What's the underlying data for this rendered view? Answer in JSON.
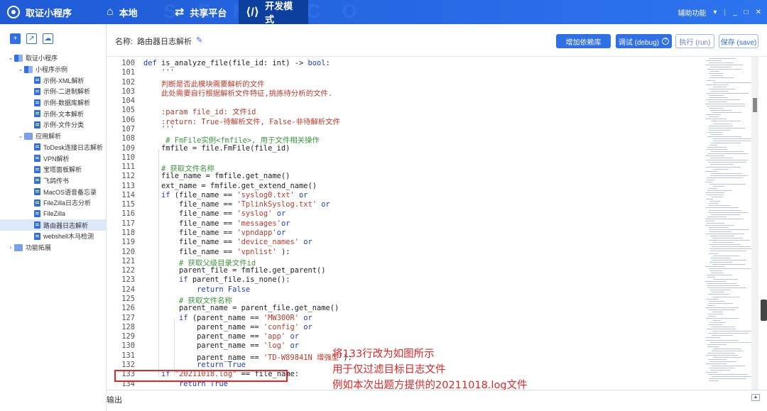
{
  "app": {
    "title": "取证小程序",
    "nav": [
      {
        "label": "本地",
        "icon": "home-icon"
      },
      {
        "label": "共享平台",
        "icon": "share-icon"
      },
      {
        "label": "开发模式",
        "icon": "code-icon"
      }
    ],
    "assist": "辅助功能",
    "winctl": {
      "sep": "|",
      "min": "_",
      "max": "□",
      "close": "✕"
    }
  },
  "sidebar": {
    "tools": [
      "+",
      "↗",
      "☁"
    ],
    "tree": [
      {
        "level": 0,
        "arrow": "⌄",
        "label": "取证小程序",
        "type": "folder"
      },
      {
        "level": 1,
        "arrow": "⌄",
        "label": "小程序示例",
        "type": "folder"
      },
      {
        "level": 2,
        "arrow": "",
        "label": "示例-XML解析",
        "type": "file"
      },
      {
        "level": 2,
        "arrow": "",
        "label": "示例-二进制解析",
        "type": "file"
      },
      {
        "level": 2,
        "arrow": "",
        "label": "示例-数据库解析",
        "type": "file"
      },
      {
        "level": 2,
        "arrow": "",
        "label": "示例-文本解析",
        "type": "file"
      },
      {
        "level": 2,
        "arrow": "",
        "label": "示例-文件分类",
        "type": "file"
      },
      {
        "level": 1,
        "arrow": "⌄",
        "label": "应用解析",
        "type": "folder2"
      },
      {
        "level": 2,
        "arrow": "",
        "label": "ToDesk连接日志解析",
        "type": "file"
      },
      {
        "level": 2,
        "arrow": "",
        "label": "VPN解析",
        "type": "file"
      },
      {
        "level": 2,
        "arrow": "",
        "label": "宝塔面板解析",
        "type": "file"
      },
      {
        "level": 2,
        "arrow": "",
        "label": "飞鸽传书",
        "type": "file"
      },
      {
        "level": 2,
        "arrow": "",
        "label": "MacOS语音备忘录",
        "type": "file"
      },
      {
        "level": 2,
        "arrow": "",
        "label": "FileZilla日志分析",
        "type": "file"
      },
      {
        "level": 2,
        "arrow": "",
        "label": "FileZilla",
        "type": "file"
      },
      {
        "level": 2,
        "arrow": "",
        "label": "路由器日志解析",
        "type": "file",
        "selected": true
      },
      {
        "level": 2,
        "arrow": "",
        "label": "webshell木马检测",
        "type": "file"
      },
      {
        "level": 0,
        "arrow": "›",
        "label": "功能拓展",
        "type": "ext"
      }
    ]
  },
  "toolbar": {
    "name_label": "名称:",
    "name_value": "路由器日志解析",
    "add_dep": "增加依赖库",
    "debug": "调试 (debug)",
    "run": "执行 (run)",
    "save": "保存 (save)"
  },
  "code": [
    {
      "n": "100",
      "t": "def is_analyze_file(file_id: int) -> bool:"
    },
    {
      "n": "101",
      "t": "    '''"
    },
    {
      "n": "102",
      "t": "    判断是否此模块需要解析的文件"
    },
    {
      "n": "103",
      "t": "    此处需要自行根据解析文件特征,挑拣待分析的文件."
    },
    {
      "n": "104",
      "t": ""
    },
    {
      "n": "105",
      "t": "    :param file_id: 文件id"
    },
    {
      "n": "106",
      "t": "    :return: True-待解析文件, False-非待解析文件"
    },
    {
      "n": "107",
      "t": "    '''"
    },
    {
      "n": "108",
      "t": "     # FmFile实例<fmfile>, 用于文件相关操作"
    },
    {
      "n": "109",
      "t": "    fmfile = file.FmFile(file_id)"
    },
    {
      "n": "110",
      "t": ""
    },
    {
      "n": "111",
      "t": "    # 获取文件名称"
    },
    {
      "n": "112",
      "t": "    file_name = fmfile.get_name()"
    },
    {
      "n": "113",
      "t": "    ext_name = fmfile.get_extend_name()"
    },
    {
      "n": "114",
      "t": "    if (file_name == 'syslog0.txt' or"
    },
    {
      "n": "115",
      "t": "        file_name == 'TplinkSyslog.txt' or"
    },
    {
      "n": "116",
      "t": "        file_name == 'syslog' or"
    },
    {
      "n": "117",
      "t": "        file_name == 'messages'or"
    },
    {
      "n": "118",
      "t": "        file_name == 'vpndapp'or"
    },
    {
      "n": "119",
      "t": "        file_name == 'device_names' or"
    },
    {
      "n": "120",
      "t": "        file_name == 'vpnlist' ):"
    },
    {
      "n": "121",
      "t": "        # 获取父级目录文件id"
    },
    {
      "n": "122",
      "t": "        parent_file = fmfile.get_parent()"
    },
    {
      "n": "123",
      "t": "        if parent_file.is_none():"
    },
    {
      "n": "124",
      "t": "            return False"
    },
    {
      "n": "125",
      "t": "        # 获取文件名称"
    },
    {
      "n": "126",
      "t": "        parent_name = parent_file.get_name()"
    },
    {
      "n": "127",
      "t": "        if (parent_name == 'MW300R' or"
    },
    {
      "n": "128",
      "t": "            parent_name == 'config' or"
    },
    {
      "n": "129",
      "t": "            parent_name == 'app' or"
    },
    {
      "n": "130",
      "t": "            parent_name == 'log' or"
    },
    {
      "n": "131",
      "t": "            parent_name == 'TD-W89841N 增强型'):"
    },
    {
      "n": "132",
      "t": "            return True"
    },
    {
      "n": "133",
      "t": "    if \"20211018.log\" == file_name:"
    },
    {
      "n": "134",
      "t": "        return True"
    }
  ],
  "annotation": [
    "将133行改为如图所示",
    "用于仅过滤目标日志文件",
    "例如本次出题方提供的20211018.log文件"
  ],
  "output": {
    "label": "输出",
    "toggle": "▲"
  },
  "colors": {
    "brand": "#1f5bd6",
    "accent": "#2f6fe8",
    "highlight": "#e52626"
  }
}
